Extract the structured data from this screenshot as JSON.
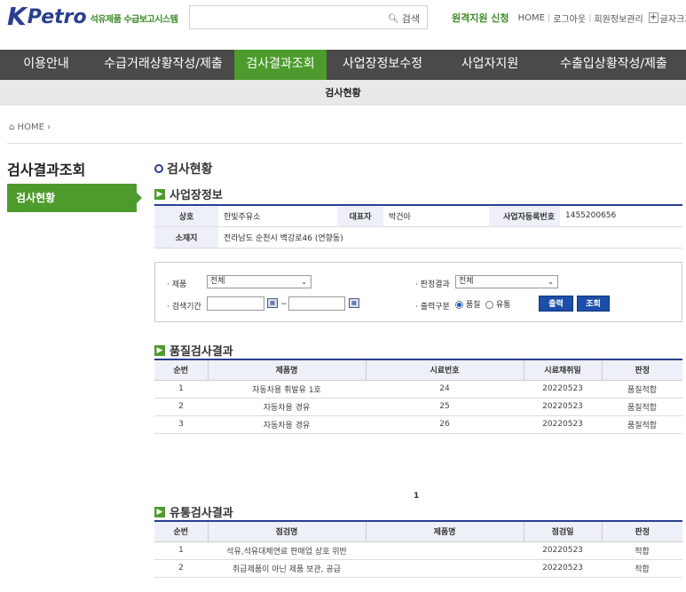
{
  "header": {
    "logo_k": "K",
    "logo_petro": "Petro",
    "logo_sub": "석유제품 수급보고시스템",
    "search_placeholder": "",
    "search_label": "검색",
    "remote_support": "원격지원 신청",
    "links": [
      "HOME",
      "로그아웃",
      "회원정보관리"
    ],
    "font_size_label": "글자크기",
    "font_plus": "+",
    "font_minus": "−"
  },
  "nav": {
    "items": [
      "이용안내",
      "수급거래상황작성/제출",
      "검사결과조회",
      "사업장정보수정",
      "사업자지원",
      "수출입상황작성/제출"
    ],
    "active_index": 2,
    "sub_item": "검사현황"
  },
  "breadcrumb": "HOME",
  "side": {
    "title": "검사결과조회",
    "items": [
      "검사현황"
    ]
  },
  "page_title": "검사현황",
  "business": {
    "section_title": "사업장정보",
    "labels": {
      "name": "상호",
      "rep": "대표자",
      "reg_no": "사업자등록번호",
      "address": "소재지"
    },
    "values": {
      "name": "한빛주유소",
      "rep": "박건아",
      "reg_no": "1455200656",
      "address": "전라남도 순천시 백강로46 (연향동)"
    }
  },
  "filter": {
    "product_label": "· 제품",
    "product_value": "전체",
    "result_label": "· 판정결과",
    "result_value": "전체",
    "period_label": "· 검색기간",
    "date_from": "",
    "date_to": "",
    "tilde": "~",
    "output_label": "· 출력구분",
    "radio_quality": "품질",
    "radio_distribution": "유통",
    "print_button": "출력",
    "search_button": "조회"
  },
  "quality": {
    "section_title": "품질검사결과",
    "columns": [
      "순번",
      "제품명",
      "시료번호",
      "시료채취일",
      "판정"
    ],
    "rows": [
      [
        "1",
        "자동차용 휘발유 1호",
        "24",
        "20220523",
        "품질적합"
      ],
      [
        "2",
        "자동차용 경유",
        "25",
        "20220523",
        "품질적합"
      ],
      [
        "3",
        "자동차용 경유",
        "26",
        "20220523",
        "품질적합"
      ]
    ]
  },
  "pager": {
    "current": "1"
  },
  "distribution": {
    "section_title": "유통검사결과",
    "columns": [
      "순번",
      "점검명",
      "제품명",
      "점검일",
      "판정"
    ],
    "rows": [
      [
        "1",
        "석유,석유대체연료 판매업 상호 위반",
        "",
        "20220523",
        "적합"
      ],
      [
        "2",
        "취급제품이 아닌 제품 보관, 공급",
        "",
        "20220523",
        "적합"
      ]
    ]
  },
  "colors": {
    "brand_blue": "#2b3f8f",
    "brand_green": "#4e9b2d",
    "nav_bg": "#4a4a4a"
  }
}
